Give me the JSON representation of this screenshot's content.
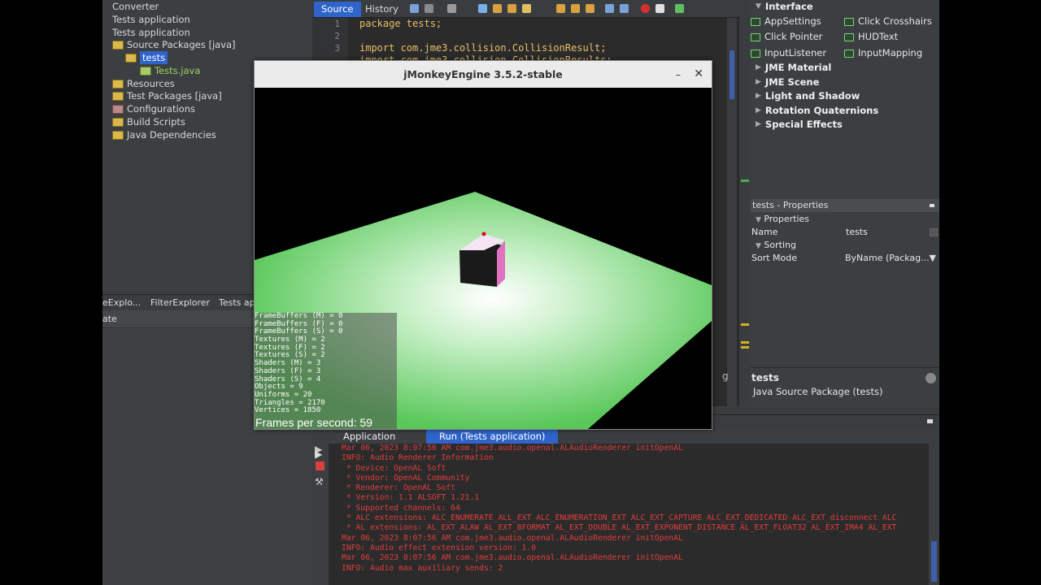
{
  "project": {
    "items": [
      {
        "label": "Converter"
      },
      {
        "label": "Tests application"
      },
      {
        "label": "Tests application"
      },
      {
        "label": "Source Packages [java]"
      },
      {
        "label": "tests"
      },
      {
        "label": "Tests.java"
      },
      {
        "label": "Resources"
      },
      {
        "label": "Test Packages [java]"
      },
      {
        "label": "Configurations"
      },
      {
        "label": "Build Scripts"
      },
      {
        "label": "Java Dependencies"
      }
    ]
  },
  "lower_left": {
    "tabs": [
      "eExplo...",
      "FilterExplorer",
      "Tests ap"
    ],
    "row": "ate"
  },
  "editor": {
    "tabs": [
      "Source",
      "History"
    ],
    "line_numbers": [
      "1",
      "2",
      "3"
    ],
    "lines": [
      "package tests;",
      "",
      "import com.jme3.collision.CollisionResult;",
      "import com.jme3.collision.CollisionResults;"
    ],
    "peek": "g"
  },
  "palette": {
    "section": "Interface",
    "items": [
      "AppSettings",
      "Click Crosshairs",
      "Click Pointer",
      "HUDText",
      "InputListener",
      "InputMapping"
    ],
    "categories": [
      "JME Material",
      "JME Scene",
      "Light and Shadow",
      "Rotation Quaternions",
      "Special Effects"
    ]
  },
  "properties": {
    "title": "tests - Properties",
    "group1": "Properties",
    "name_label": "Name",
    "name_value": "tests",
    "group2": "Sorting",
    "sort_label": "Sort Mode",
    "sort_value": "ByName (Packag..."
  },
  "help": {
    "title": "tests",
    "desc": "Java Source Package (tests)"
  },
  "output": {
    "tabs": [
      "Application",
      "Run (Tests application)"
    ],
    "lines": [
      "Mar 06, 2023 8:07:56 AM com.jme3.audio.openal.ALAudioRenderer initOpenAL",
      "INFO: Audio Renderer Information",
      " * Device: OpenAL Soft",
      " * Vendor: OpenAL Community",
      " * Renderer: OpenAL Soft",
      " * Version: 1.1 ALSOFT 1.21.1",
      " * Supported channels: 64",
      " * ALC extensions: ALC_ENUMERATE_ALL_EXT ALC_ENUMERATION_EXT ALC_EXT_CAPTURE ALC_EXT_DEDICATED ALC_EXT_disconnect ALC",
      " * AL extensions: AL_EXT_ALAW AL_EXT_BFORMAT AL_EXT_DOUBLE AL_EXT_EXPONENT_DISTANCE AL_EXT_FLOAT32 AL_EXT_IMA4 AL_EXT",
      "Mar 06, 2023 8:07:56 AM com.jme3.audio.openal.ALAudioRenderer initOpenAL",
      "INFO: Audio effect extension version: 1.0",
      "Mar 06, 2023 8:07:56 AM com.jme3.audio.openal.ALAudioRenderer initOpenAL",
      "INFO: Audio max auxiliary sends: 2"
    ]
  },
  "game": {
    "title": "jMonkeyEngine 3.5.2-stable",
    "stats": [
      "FrameBuffers (M) = 0",
      "FrameBuffers (F) = 0",
      "FrameBuffers (S) = 0",
      "Textures (M) = 2",
      "Textures (F) = 2",
      "Textures (S) = 2",
      "Shaders (M) = 3",
      "Shaders (F) = 3",
      "Shaders (S) = 4",
      "Objects = 9",
      "Uniforms = 20",
      "Triangles = 2170",
      "Vertices = 1850"
    ],
    "fps_text": "Frames per second: 59"
  },
  "colors": {
    "selection": "#2f65ca",
    "floor": "#59c859",
    "error_text": "#e23c3c"
  }
}
